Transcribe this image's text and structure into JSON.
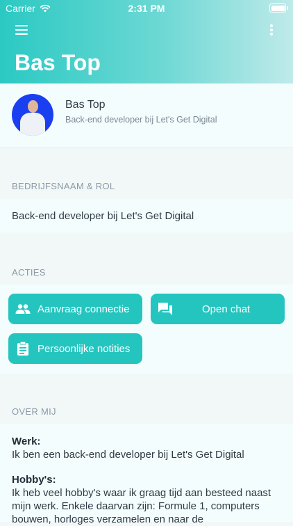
{
  "status": {
    "carrier": "Carrier",
    "time": "2:31 PM"
  },
  "header": {
    "title": "Bas Top"
  },
  "profile": {
    "name": "Bas Top",
    "subtitle": "Back-end developer bij Let's Get Digital"
  },
  "company_section": {
    "label": "BEDRIJFSNAAM & ROL",
    "value": "Back-end developer bij Let's Get Digital"
  },
  "actions": {
    "label": "ACTIES",
    "request_connection": "Aanvraag connectie",
    "open_chat": "Open chat",
    "personal_notes": "Persoonlijke notities"
  },
  "about": {
    "label": "OVER MIJ",
    "work_title": "Werk:",
    "work_text": "Ik ben een back-end developer bij Let's Get Digital",
    "hobby_title": "Hobby's:",
    "hobby_text": "Ik heb veel hobby's waar ik graag tijd aan besteed naast mijn werk. Enkele daarvan zijn: Formule 1, computers bouwen, horloges verzamelen en naar de"
  },
  "colors": {
    "accent": "#25c5bf",
    "avatar_bg": "#1a3ff0"
  },
  "icons": {
    "menu": "menu-icon",
    "more": "more-vertical-icon",
    "people": "people-icon",
    "chat": "chat-icon",
    "clipboard": "clipboard-icon"
  }
}
